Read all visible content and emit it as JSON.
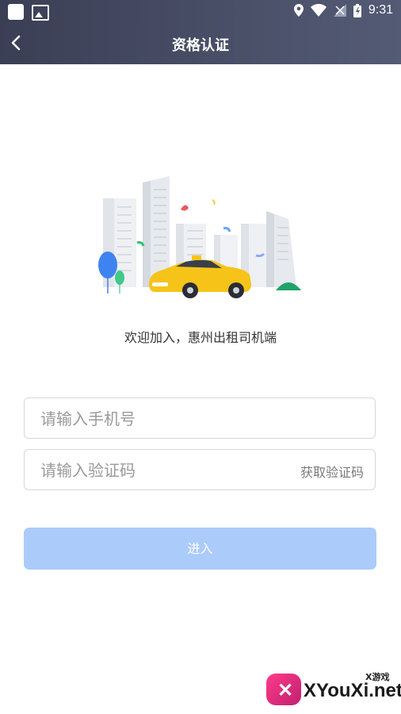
{
  "status_bar": {
    "time": "9:31",
    "icons": [
      "app-icon",
      "image-icon",
      "location-icon",
      "wifi-icon",
      "signal-icon",
      "battery-icon"
    ]
  },
  "header": {
    "title": "资格认证",
    "back_icon": "chevron-left-icon"
  },
  "welcome_text": "欢迎加入，惠州出租司机端",
  "form": {
    "phone_placeholder": "请输入手机号",
    "code_placeholder": "请输入验证码",
    "get_code_label": "获取验证码"
  },
  "enter_button": {
    "label": "进入"
  },
  "watermark": {
    "text": "XYouXi.net",
    "small_text": "X游戏"
  },
  "colors": {
    "header_bg": "#464b63",
    "button_disabled": "#abcbfa",
    "taxi_yellow": "#f6c419"
  }
}
